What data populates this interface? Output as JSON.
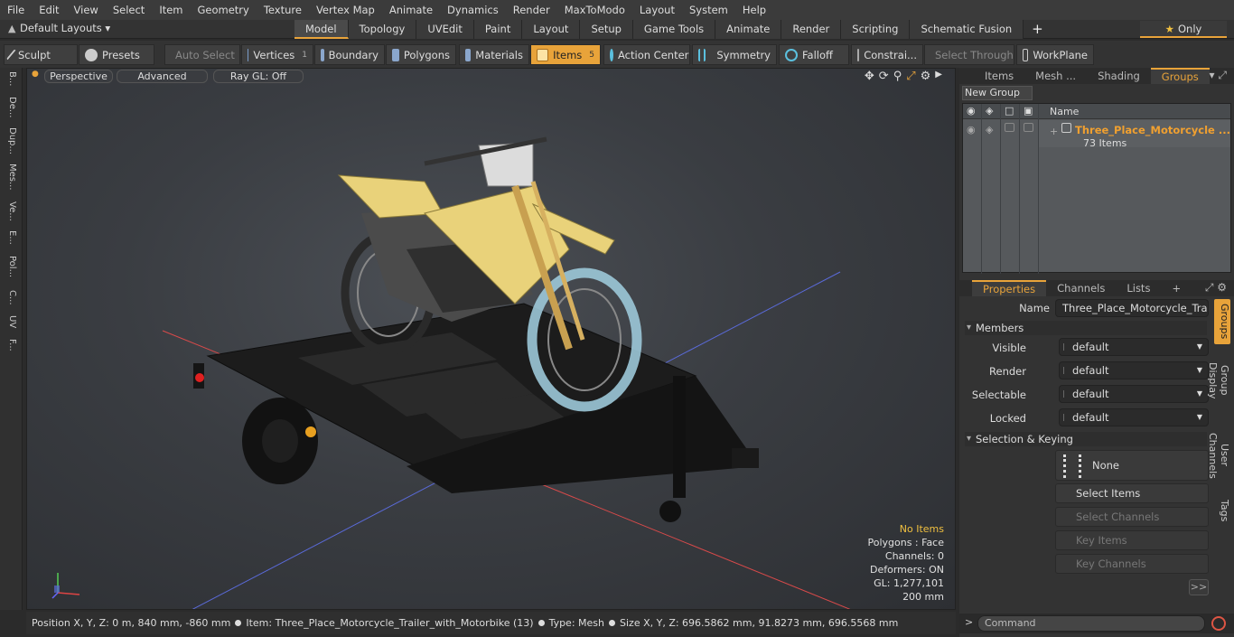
{
  "menubar": [
    "File",
    "Edit",
    "View",
    "Select",
    "Item",
    "Geometry",
    "Texture",
    "Vertex Map",
    "Animate",
    "Dynamics",
    "Render",
    "MaxToModo",
    "Layout",
    "System",
    "Help"
  ],
  "layout": {
    "name": "Default Layouts ▾",
    "tabs": [
      "Model",
      "Topology",
      "UVEdit",
      "Paint",
      "Layout",
      "Setup",
      "Game Tools",
      "Animate",
      "Render",
      "Scripting",
      "Schematic Fusion"
    ],
    "only": "Only"
  },
  "toolbar": {
    "sculpt": "Sculpt",
    "presets": "Presets",
    "auto_select": "Auto Select",
    "vertices": "Vertices",
    "vertices_count": "1",
    "boundary": "Boundary",
    "polygons": "Polygons",
    "materials": "Materials",
    "items": "Items",
    "items_count": "5",
    "action_center": "Action Center",
    "symmetry": "Symmetry",
    "falloff": "Falloff",
    "constrain": "Constrai...",
    "select_through": "Select Through",
    "workplane": "WorkPlane"
  },
  "lefttabs": [
    "B...",
    "De...",
    "Dup...",
    "Mes...",
    "Ve...",
    "E...",
    "Pol...",
    "C...",
    "UV",
    "F..."
  ],
  "viewport": {
    "perspective": "Perspective",
    "advanced": "Advanced",
    "raygl": "Ray GL: Off",
    "info": {
      "no_items": "No Items",
      "polygons": "Polygons : Face",
      "channels": "Channels: 0",
      "deformers": "Deformers: ON",
      "gl": "GL: 1,277,101",
      "scale": "200 mm"
    }
  },
  "statusbar": {
    "position": "Position X, Y, Z:   0 m, 840 mm, -860 mm",
    "item": "Item:  Three_Place_Motorcycle_Trailer_with_Motorbike (13)",
    "type": "Type:  Mesh",
    "size": "Size X, Y, Z:   696.5862 mm, 91.8273 mm, 696.5568 mm"
  },
  "groups_panel": {
    "tabs": [
      "Items",
      "Mesh ...",
      "Shading",
      "Groups"
    ],
    "new_group": "New Group",
    "col_name": "Name",
    "group_name": "Three_Place_Motorcycle ...",
    "group_count": "73 Items"
  },
  "properties": {
    "tabs": [
      "Properties",
      "Channels",
      "Lists"
    ],
    "name_label": "Name",
    "name_value": "Three_Place_Motorcycle_Trailer_",
    "members": "Members",
    "visible_label": "Visible",
    "visible": "default",
    "render_label": "Render",
    "render": "default",
    "selectable_label": "Selectable",
    "selectable": "default",
    "locked_label": "Locked",
    "locked": "default",
    "sel_keying": "Selection & Keying",
    "none": "None",
    "select_items": "Select Items",
    "select_channels": "Select Channels",
    "key_items": "Key Items",
    "key_channels": "Key Channels",
    "fwd": ">>"
  },
  "vtabs": [
    "Groups",
    "Group Display",
    "User Channels",
    "Tags"
  ],
  "command": {
    "placeholder": "Command"
  }
}
